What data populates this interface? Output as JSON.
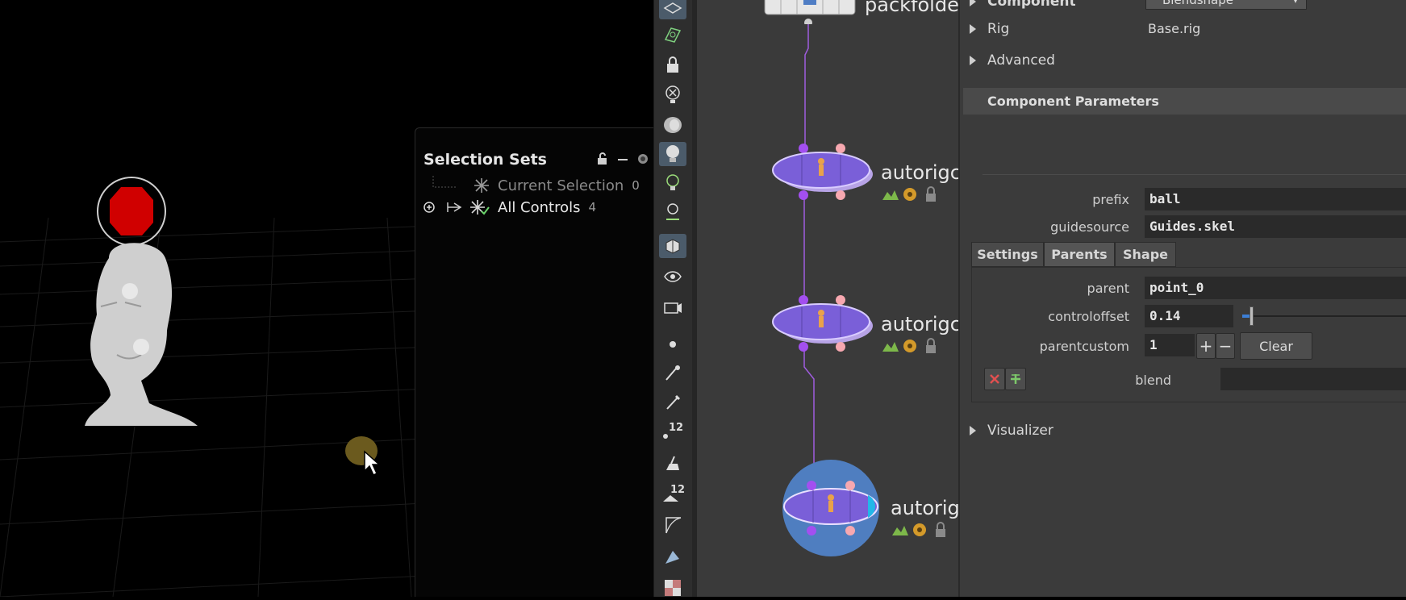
{
  "viewport": {
    "selection_sets": {
      "title": "Selection Sets",
      "rows": [
        {
          "label": "Current Selection",
          "count": "0"
        },
        {
          "label": "All Controls",
          "count": "4"
        }
      ]
    }
  },
  "network": {
    "top_node_label": "packfolder",
    "nodes": [
      {
        "label": "autorigco"
      },
      {
        "label": "autorigco"
      },
      {
        "label": "autorigc"
      }
    ]
  },
  "params": {
    "component_label": "Component",
    "component_value": "Blendshape",
    "rig_label": "Rig",
    "rig_value": "Base.rig",
    "advanced_label": "Advanced",
    "section_title": "Component Parameters",
    "prefix_label": "prefix",
    "prefix_value": "ball",
    "guidesource_label": "guidesource",
    "guidesource_value": "Guides.skel",
    "tabs": [
      "Settings",
      "Parents",
      "Shape"
    ],
    "parent_label": "parent",
    "parent_value": "point_0",
    "controloffset_label": "controloffset",
    "controloffset_value": "0.14",
    "parentcustom_label": "parentcustom",
    "parentcustom_value": "1",
    "clear_label": "Clear",
    "blend_label": "blend",
    "visualizer_label": "Visualizer"
  }
}
